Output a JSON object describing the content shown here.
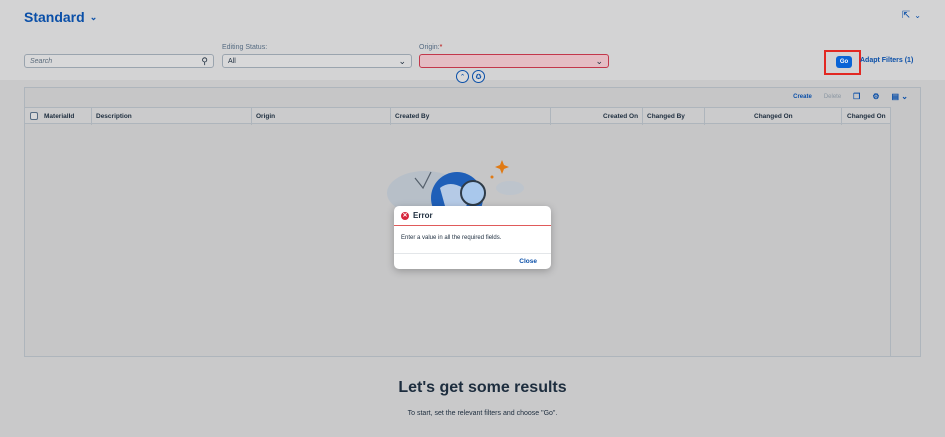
{
  "header": {
    "variant_title": "Standard",
    "variant_chevron": "chevron-down-icon",
    "share_icon": "share-icon"
  },
  "filters": {
    "search": {
      "placeholder": "Search",
      "icon": "search-icon"
    },
    "editing_status": {
      "label": "Editing Status:",
      "value": "All"
    },
    "origin": {
      "label": "Origin:",
      "required_mark": "*",
      "value": ""
    },
    "go_label": "Go",
    "adapt_label": "Adapt Filters (1)"
  },
  "table": {
    "toolbar": {
      "create": "Create",
      "delete": "Delete"
    },
    "columns": [
      "MaterialId",
      "Description",
      "Origin",
      "Created By",
      "Created On",
      "Changed By",
      "Changed On",
      "Changed On"
    ]
  },
  "empty_state": {
    "title": "Let's get some results",
    "subtitle": "To start, set the relevant filters and choose \"Go\"."
  },
  "dialog": {
    "title": "Error",
    "message": "Enter a value in all the required fields.",
    "close_label": "Close"
  },
  "colors": {
    "brand_blue": "#0a64d6",
    "link_blue": "#0a4fa8",
    "error_red": "#d7263d",
    "highlight_red": "#e22822"
  }
}
